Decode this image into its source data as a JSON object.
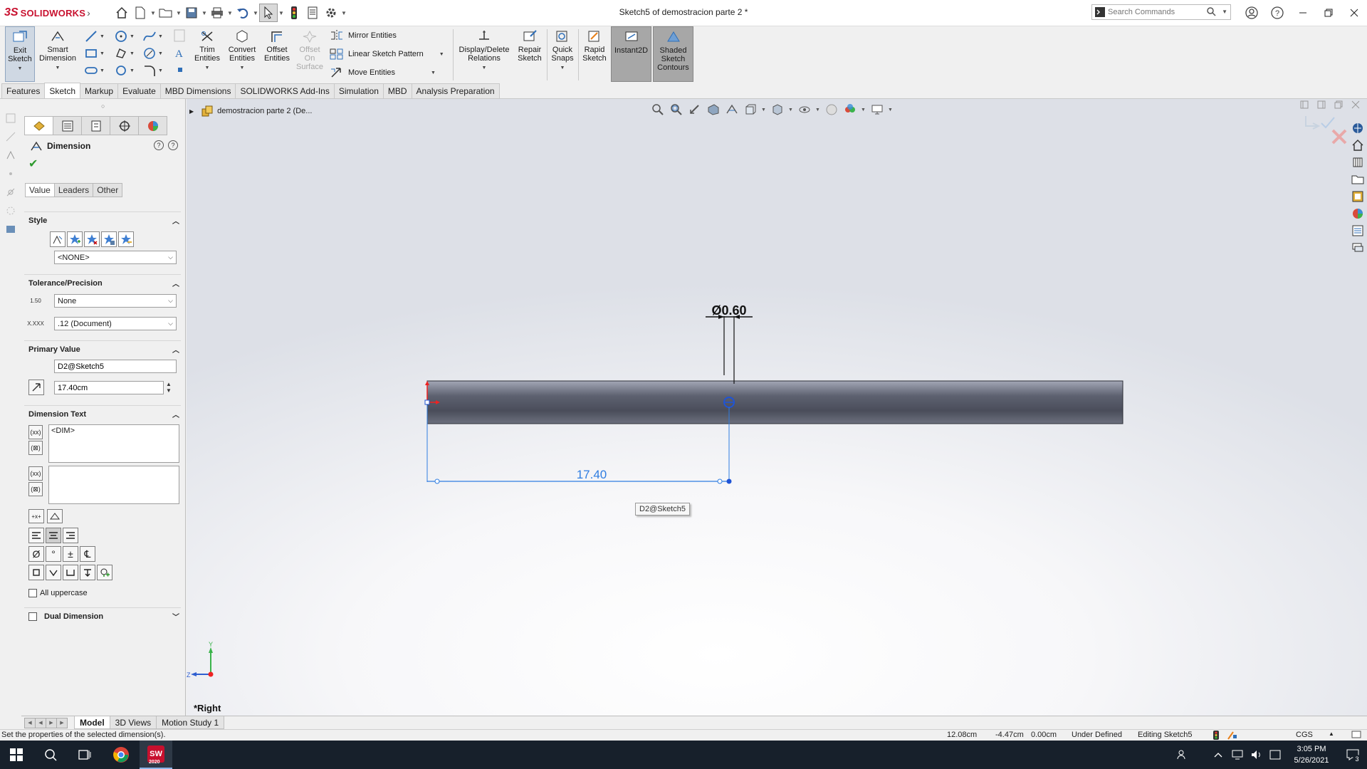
{
  "app": {
    "brand_prefix": "3S",
    "brand_name": "SOLIDWORKS",
    "document_title": "Sketch5 of demostracion parte 2 *",
    "search_placeholder": "Search Commands"
  },
  "ribbon": {
    "exit_sketch": "Exit\nSketch",
    "smart_dimension": "Smart\nDimension",
    "trim_entities": "Trim\nEntities",
    "convert_entities": "Convert\nEntities",
    "offset_entities": "Offset\nEntities",
    "offset_on_surface": "Offset\nOn\nSurface",
    "mirror_entities": "Mirror Entities",
    "linear_sketch_pattern": "Linear Sketch Pattern",
    "move_entities": "Move Entities",
    "display_delete_relations": "Display/Delete\nRelations",
    "repair_sketch": "Repair\nSketch",
    "quick_snaps": "Quick\nSnaps",
    "rapid_sketch": "Rapid\nSketch",
    "instant2d": "Instant2D",
    "shaded_sketch_contours": "Shaded\nSketch\nContours"
  },
  "tabs": [
    "Features",
    "Sketch",
    "Markup",
    "Evaluate",
    "MBD Dimensions",
    "SOLIDWORKS Add-Ins",
    "Simulation",
    "MBD",
    "Analysis Preparation"
  ],
  "active_tab": "Sketch",
  "property_manager": {
    "title": "Dimension",
    "help": "?",
    "sub_tabs": [
      "Value",
      "Leaders",
      "Other"
    ],
    "style": {
      "heading": "Style",
      "selected": "<NONE>"
    },
    "tolerance": {
      "heading": "Tolerance/Precision",
      "tolerance_type": "None",
      "precision": ".12 (Document)",
      "tol_icon_text": "1.50",
      "prec_icon_text": "X.XXX"
    },
    "primary_value": {
      "heading": "Primary Value",
      "name": "D2@Sketch5",
      "value": "17.40cm"
    },
    "dimension_text": {
      "heading": "Dimension Text",
      "text_above": "<DIM>",
      "text_below": ""
    },
    "symbols": [
      "Ø",
      "°",
      "±",
      "℄"
    ],
    "all_uppercase": "All uppercase",
    "dual_dimension": "Dual Dimension"
  },
  "graphics": {
    "tree_label": "demostracion parte 2  (De...",
    "diameter_dim": "Ø0.60",
    "linear_dim": "17.40",
    "dim_tooltip": "D2@Sketch5",
    "view_label": "*Right",
    "axis_y": "Y",
    "axis_z": "Z"
  },
  "bottom_tabs": [
    "Model",
    "3D Views",
    "Motion Study 1"
  ],
  "status": {
    "message": "Set the properties of the selected dimension(s).",
    "x": "12.08cm",
    "y": "-4.47cm",
    "z": "0.00cm",
    "state": "Under Defined",
    "editing": "Editing Sketch5",
    "units": "CGS"
  },
  "taskbar": {
    "sw_badge": "2020",
    "time": "3:05 PM",
    "date": "5/26/2021",
    "notif_count": "3"
  },
  "colors": {
    "brand_red": "#c8102e",
    "dimension_blue": "#2f7de1",
    "selection_blue": "#1f54d6",
    "part_dark": "#4a4d5a",
    "accept_green": "#2e9a2e"
  }
}
